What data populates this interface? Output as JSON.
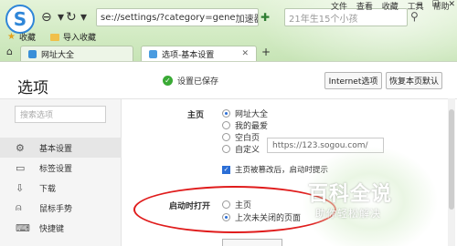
{
  "browser": {
    "menu": [
      "文件",
      "查看",
      "收藏",
      "工具",
      "帮助"
    ],
    "address_url": "se://settings/?category=gene",
    "address_accel": "加速器",
    "search_placeholder": "21年生15个小孩",
    "bookmarks": [
      {
        "label": "收藏"
      },
      {
        "label": "导入收藏"
      }
    ],
    "tabs": [
      {
        "label": "网址大全",
        "active": false
      },
      {
        "label": "选项-基本设置",
        "active": true
      }
    ]
  },
  "page": {
    "title": "选项",
    "saved_status": "设置已保存",
    "buttons": {
      "internet_options": "Internet选项",
      "restore_defaults": "恢复本页默认"
    },
    "sidebar": {
      "search_placeholder": "搜索选项",
      "items": [
        {
          "label": "基本设置",
          "icon": "gear-icon",
          "active": true
        },
        {
          "label": "标签设置",
          "icon": "tab-icon",
          "active": false
        },
        {
          "label": "下载",
          "icon": "download-icon",
          "active": false
        },
        {
          "label": "鼠标手势",
          "icon": "mouse-icon",
          "active": false
        },
        {
          "label": "快捷键",
          "icon": "keyboard-icon",
          "active": false
        }
      ]
    },
    "homepage": {
      "label": "主页",
      "options": [
        {
          "label": "网址大全",
          "selected": true
        },
        {
          "label": "我的最爱",
          "selected": false
        },
        {
          "label": "空白页",
          "selected": false
        },
        {
          "label": "自定义",
          "selected": false
        }
      ],
      "custom_url_placeholder": "https://123.sogou.com/",
      "checkbox_label": "主页被篡改后，启动时提示"
    },
    "startup": {
      "label": "启动时打开",
      "options": [
        {
          "label": "主页",
          "selected": false
        },
        {
          "label": "上次未关闭的页面",
          "selected": true
        }
      ]
    },
    "watermark": {
      "main": "百科全说",
      "sub": "助你轻松解决"
    },
    "colors": {
      "accent": "#2b6ed6",
      "highlight_oval": "#e01c1c",
      "success": "#3aaa35"
    }
  }
}
